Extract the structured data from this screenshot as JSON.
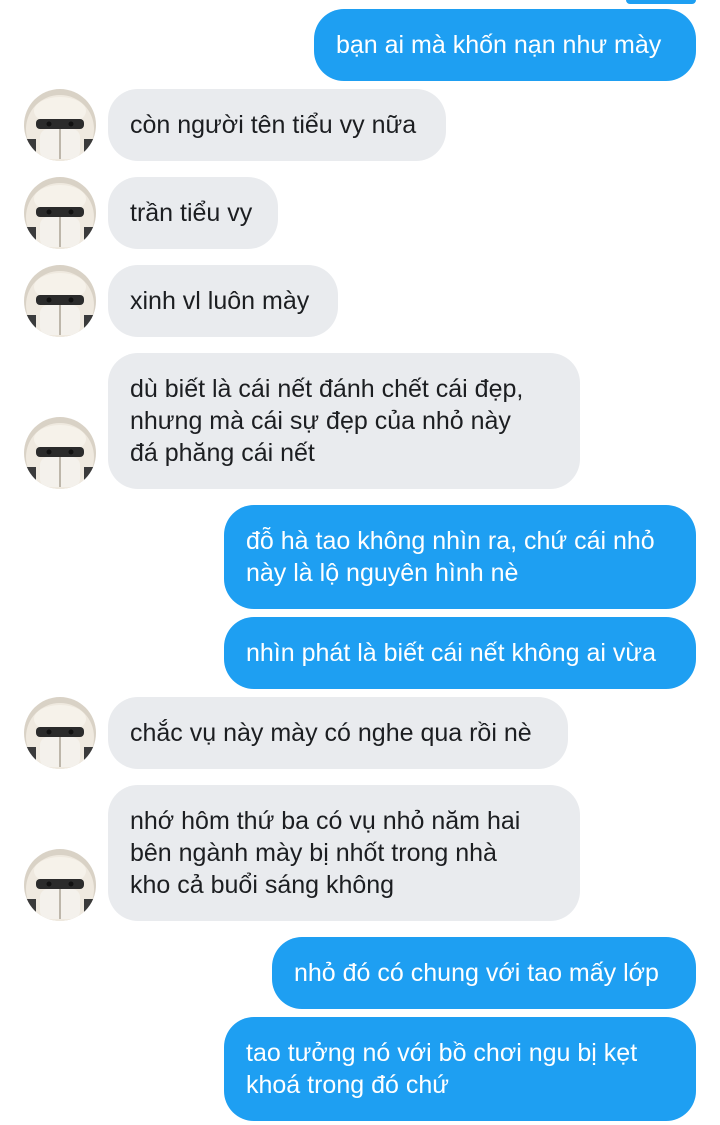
{
  "messages": [
    {
      "direction": "outgoing",
      "text": "bạn ai mà khốn nạn như mày"
    },
    {
      "direction": "incoming",
      "text": "còn người tên tiểu vy nữa"
    },
    {
      "direction": "incoming",
      "text": "trần tiểu vy"
    },
    {
      "direction": "incoming",
      "text": "xinh vl luôn mày"
    },
    {
      "direction": "incoming",
      "text": "dù biết là cái nết đánh chết cái đẹp,\nnhưng mà cái sự đẹp của nhỏ này\nđá phăng cái nết"
    },
    {
      "direction": "outgoing",
      "text": "đỗ hà tao không nhìn ra, chứ cái nhỏ\nnày là lộ nguyên hình nè"
    },
    {
      "direction": "outgoing",
      "text": "nhìn phát là biết cái nết không ai vừa"
    },
    {
      "direction": "incoming",
      "text": "chắc vụ này mày có nghe qua rồi nè"
    },
    {
      "direction": "incoming",
      "text": "nhớ hôm thứ ba có vụ nhỏ năm hai\nbên ngành mày bị nhốt trong nhà\nkho cả buổi sáng không"
    },
    {
      "direction": "outgoing",
      "text": "nhỏ đó có chung với tao mấy lớp"
    },
    {
      "direction": "outgoing",
      "text": "tao tưởng nó với bồ chơi ngu bị kẹt\nkhoá trong đó chứ"
    }
  ],
  "colors": {
    "outgoing_bubble": "#1e9ff2",
    "incoming_bubble": "#e9ebee",
    "background": "#ffffff"
  },
  "contact": {
    "avatar_icon": "hooded-person-avatar-icon"
  }
}
